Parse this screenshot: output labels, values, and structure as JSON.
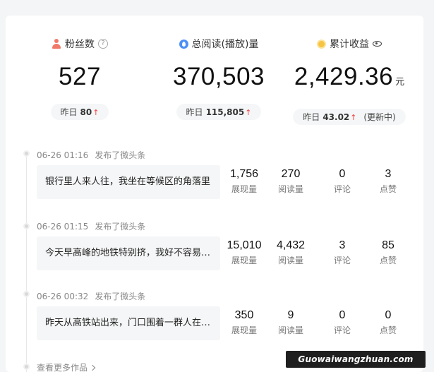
{
  "stats": [
    {
      "title": "粉丝数",
      "value": "527",
      "unit": "",
      "yesterday_label": "昨日",
      "yesterday_value": "80",
      "suffix": ""
    },
    {
      "title": "总阅读(播放)量",
      "value": "370,503",
      "unit": "",
      "yesterday_label": "昨日",
      "yesterday_value": "115,805",
      "suffix": ""
    },
    {
      "title": "累计收益",
      "value": "2,429.36",
      "unit": "元",
      "yesterday_label": "昨日",
      "yesterday_value": "43.02",
      "suffix": "(更新中)"
    }
  ],
  "icons": {
    "fans": "user-icon",
    "help": "help-circle-icon",
    "reads": "drop-icon",
    "income": "coin-icon",
    "visibility": "eye-icon",
    "trend": "arrow-up-icon"
  },
  "colors": {
    "accent_up": "#f04142",
    "fans_icon": "#f07a6a",
    "reads_icon": "#4e8ff7",
    "coin_icon": "#f6c343"
  },
  "posts": [
    {
      "time": "06-26 01:16",
      "action": "发布了微头条",
      "text": "银行里人来人往，我坐在等候区的角落里",
      "metrics": [
        {
          "value": "1,756",
          "label": "展现量"
        },
        {
          "value": "270",
          "label": "阅读量"
        },
        {
          "value": "0",
          "label": "评论"
        },
        {
          "value": "3",
          "label": "点赞"
        }
      ]
    },
    {
      "time": "06-26 01:15",
      "action": "发布了微头条",
      "text": "今天早高峰的地铁特别挤，我好不容易才挤上车",
      "metrics": [
        {
          "value": "15,010",
          "label": "展现量"
        },
        {
          "value": "4,432",
          "label": "阅读量"
        },
        {
          "value": "3",
          "label": "评论"
        },
        {
          "value": "85",
          "label": "点赞"
        }
      ]
    },
    {
      "time": "06-26 00:32",
      "action": "发布了微头条",
      "text": "昨天从高铁站出来，门口围着一群人在看热闹",
      "metrics": [
        {
          "value": "350",
          "label": "展现量"
        },
        {
          "value": "9",
          "label": "阅读量"
        },
        {
          "value": "0",
          "label": "评论"
        },
        {
          "value": "0",
          "label": "点赞"
        }
      ]
    }
  ],
  "more_link": "查看更多作品",
  "watermark": "Guowaiwangzhuan.com",
  "trend_glyph": "↑"
}
